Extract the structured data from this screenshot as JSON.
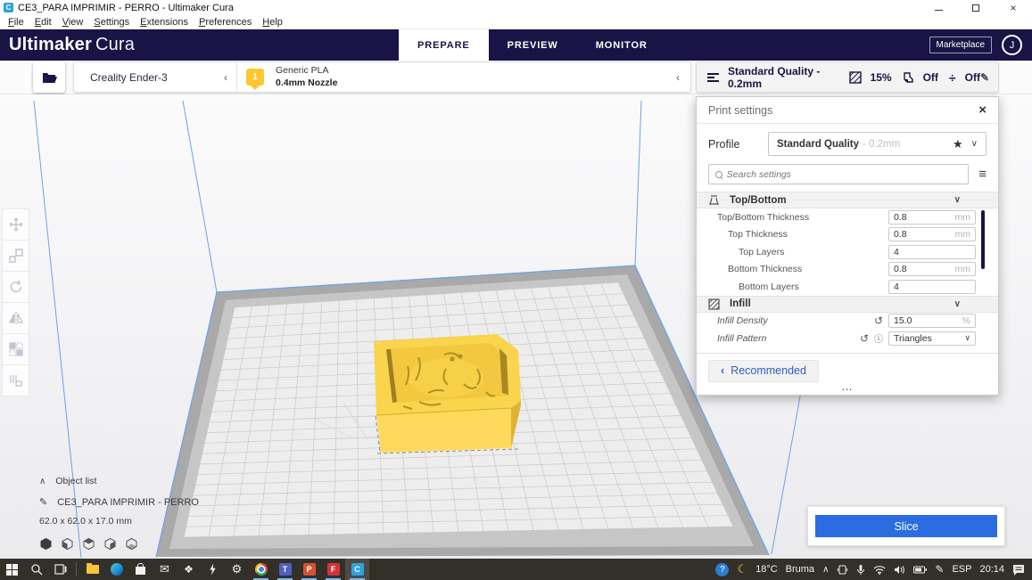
{
  "window": {
    "title": "CE3_PARA IMPRIMIR - PERRO - Ultimaker Cura",
    "app_initial": "C"
  },
  "menu": {
    "items": [
      "File",
      "Edit",
      "View",
      "Settings",
      "Extensions",
      "Preferences",
      "Help"
    ]
  },
  "header": {
    "brand_bold": "Ultimaker",
    "brand_light": "Cura",
    "tabs": [
      "PREPARE",
      "PREVIEW",
      "MONITOR"
    ],
    "active_tab": "PREPARE",
    "marketplace": "Marketplace",
    "avatar": "J"
  },
  "toolbar": {
    "printer_name": "Creality Ender-3",
    "extruder_number": "1",
    "material_name": "Generic PLA",
    "nozzle_size": "0.4mm Nozzle",
    "profile_summary": "Standard Quality - 0.2mm",
    "infill_summary": "15%",
    "support_summary": "Off",
    "adhesion_summary": "Off"
  },
  "print_settings": {
    "title": "Print settings",
    "profile_label": "Profile",
    "profile_name": "Standard Quality",
    "profile_detail": "- 0.2mm",
    "search_placeholder": "Search settings",
    "section_top_bottom": {
      "name": "Top/Bottom",
      "rows": [
        {
          "label": "Top/Bottom Thickness",
          "value": "0.8",
          "unit": "mm"
        },
        {
          "label": "Top Thickness",
          "value": "0.8",
          "unit": "mm"
        },
        {
          "label": "Top Layers",
          "value": "4",
          "unit": ""
        },
        {
          "label": "Bottom Thickness",
          "value": "0.8",
          "unit": "mm"
        },
        {
          "label": "Bottom Layers",
          "value": "4",
          "unit": ""
        }
      ]
    },
    "section_infill": {
      "name": "Infill",
      "rows": [
        {
          "label": "Infill Density",
          "value": "15.0",
          "unit": "%"
        },
        {
          "label": "Infill Pattern",
          "value": "Triangles",
          "unit": ""
        }
      ]
    },
    "recommended": "Recommended"
  },
  "viewport": {
    "object_list_label": "Object list",
    "object_name": "CE3_PARA IMPRIMIR - PERRO",
    "object_dimensions": "62.0 x 62.0 x 17.0 mm",
    "slice_button": "Slice"
  },
  "taskbar": {
    "temperature": "18°C",
    "weather": "Bruma",
    "language": "ESP",
    "time": "20:14"
  },
  "icons": {
    "collapse": "‹",
    "chevron_down": "∨",
    "chevron_up": "∧",
    "close": "×",
    "star": "★",
    "hamburger": "≡",
    "reset": "↺",
    "info": "ⓘ",
    "dots": "⋯",
    "pencil": "✎",
    "adhesion": "÷",
    "gear": "⚙",
    "moon": "☾",
    "dropbox": "❖",
    "mail": "✉",
    "help": "?",
    "teams_initial": "T",
    "powerpoint_initial": "P",
    "f_app_initial": "F",
    "cura_initial": "C"
  },
  "colors": {
    "accent_navy": "#1a1446",
    "slice_blue": "#2b6de0",
    "link_blue": "#2a5fc8",
    "material_yellow": "#fdc72f",
    "model_yellow": "#f8d24a",
    "wireframe_blue": "#6ba2e8"
  }
}
